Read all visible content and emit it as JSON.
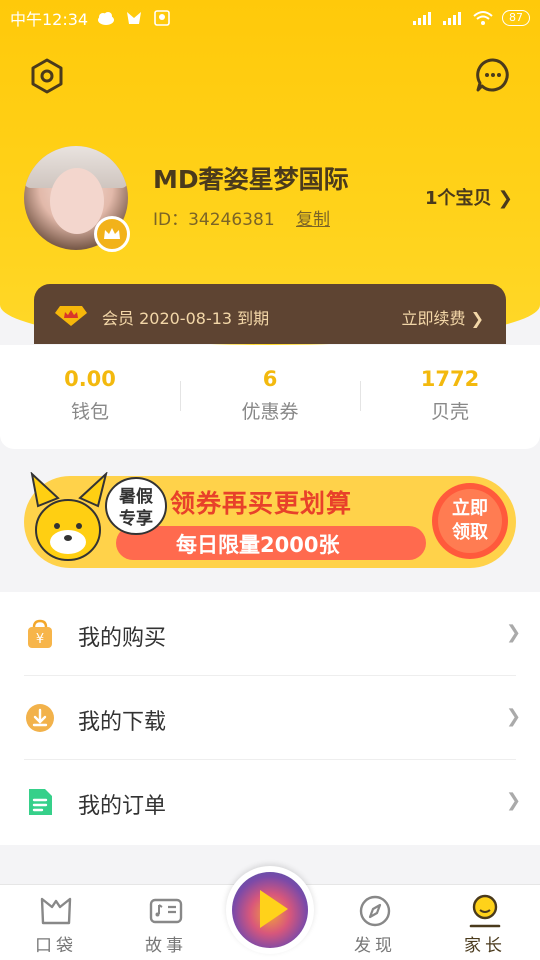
{
  "status_bar": {
    "carrier_time": "中午12:34",
    "battery": "87"
  },
  "profile": {
    "name": "MD奢姿星梦国际",
    "id_text": "ID：34246381",
    "copy_label": "复制",
    "baby_count": "1个宝贝 ❯"
  },
  "vip": {
    "text": "会员 2020-08-13 到期",
    "renew": "立即续费 ❯"
  },
  "stats": [
    {
      "value": "0.00",
      "label": "钱包"
    },
    {
      "value": "6",
      "label": "优惠券"
    },
    {
      "value": "1772",
      "label": "贝壳"
    }
  ],
  "banner": {
    "badge": "暑假专享",
    "title": "领券再买更划算",
    "subtitle": "每日限量2000张",
    "cta": "立即领取"
  },
  "menu": [
    {
      "label": "我的购买",
      "icon": "shopping-bag-icon"
    },
    {
      "label": "我的下载",
      "icon": "download-icon"
    },
    {
      "label": "我的订单",
      "icon": "order-doc-icon"
    }
  ],
  "tabs": [
    {
      "label": "口袋",
      "icon": "pocket-icon"
    },
    {
      "label": "故事",
      "icon": "story-icon"
    },
    {
      "label": "发现",
      "icon": "compass-icon"
    },
    {
      "label": "家长",
      "icon": "parent-icon"
    }
  ],
  "colors": {
    "accent_yellow": "#FFD21A",
    "vip_brown": "#5E4432",
    "stat_value": "#F3B90E"
  }
}
